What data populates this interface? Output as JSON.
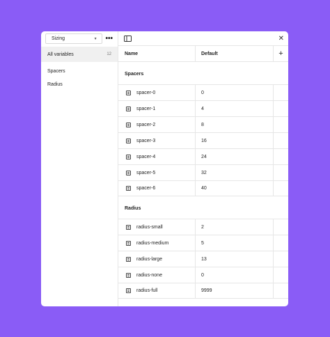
{
  "sidebar": {
    "collection": "Sizing",
    "all_label": "All variables",
    "all_count": "12",
    "groups": [
      "Spacers",
      "Radius"
    ]
  },
  "table": {
    "col_name": "Name",
    "col_default": "Default",
    "sections": [
      {
        "title": "Spacers",
        "rows": [
          {
            "name": "spacer-0",
            "value": "0"
          },
          {
            "name": "spacer-1",
            "value": "4"
          },
          {
            "name": "spacer-2",
            "value": "8"
          },
          {
            "name": "spacer-3",
            "value": "16"
          },
          {
            "name": "spacer-4",
            "value": "24"
          },
          {
            "name": "spacer-5",
            "value": "32"
          },
          {
            "name": "spacer-6",
            "value": "40"
          }
        ]
      },
      {
        "title": "Radius",
        "rows": [
          {
            "name": "radius-small",
            "value": "2"
          },
          {
            "name": "radius-medium",
            "value": "5"
          },
          {
            "name": "radius-large",
            "value": "13"
          },
          {
            "name": "radius-none",
            "value": "0"
          },
          {
            "name": "radius-full",
            "value": "9999"
          }
        ]
      }
    ]
  },
  "icons": {
    "more": "more-icon",
    "sidebar_toggle": "sidebar-toggle-icon",
    "close": "close-icon",
    "add": "plus-icon",
    "variable": "number-variable-icon"
  },
  "colors": {
    "background": "#8a5cf6",
    "panel": "#ffffff",
    "selected": "#f0f0f0"
  }
}
